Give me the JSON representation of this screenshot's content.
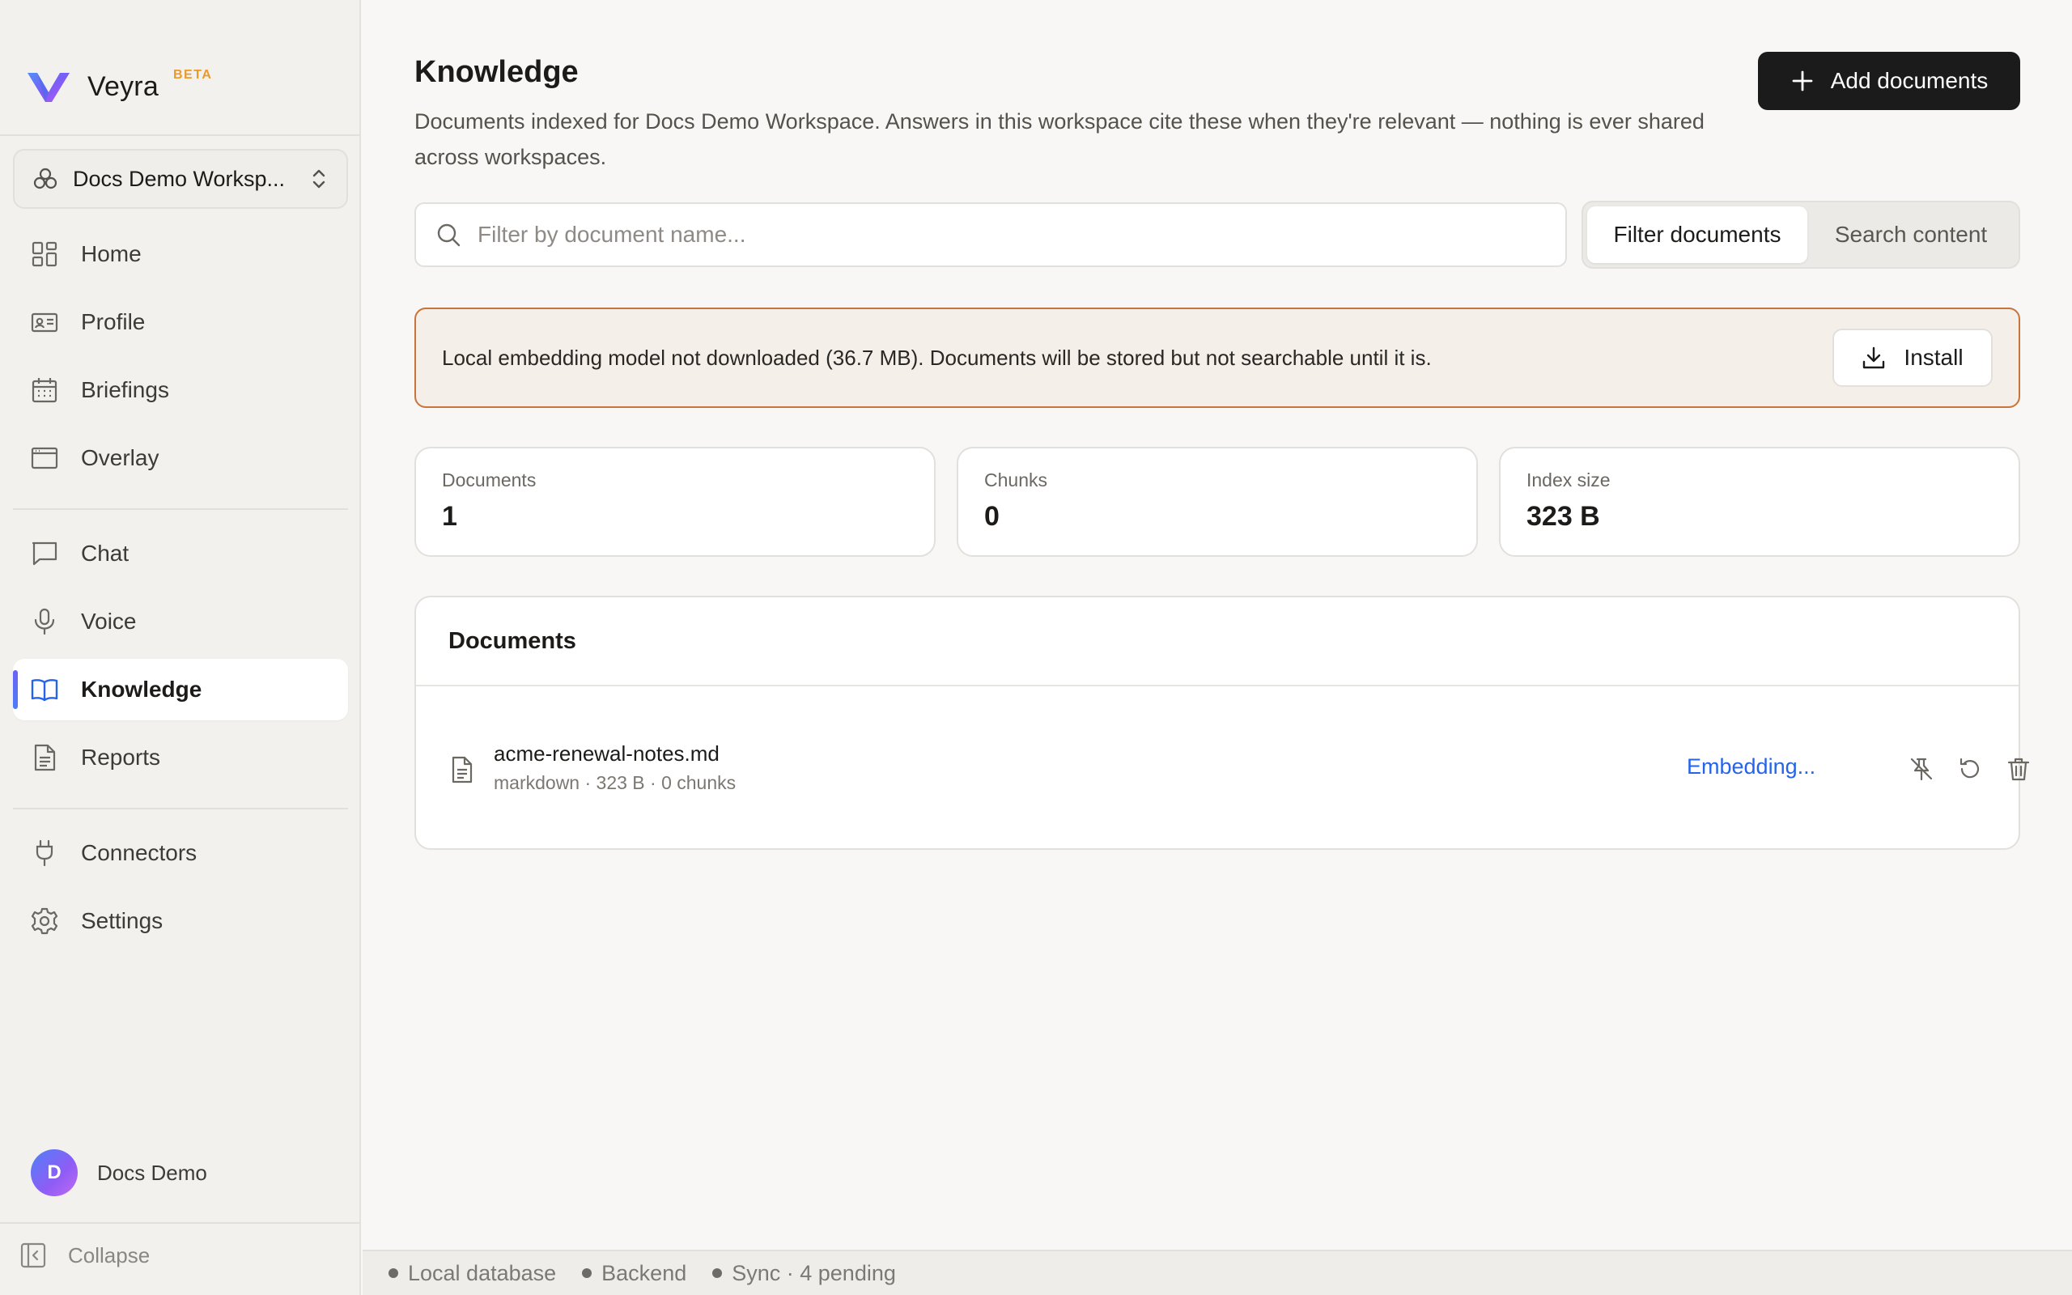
{
  "app": {
    "name": "Veyra",
    "badge": "BETA"
  },
  "workspace": {
    "name": "Docs Demo Worksp..."
  },
  "nav": {
    "home": "Home",
    "profile": "Profile",
    "briefings": "Briefings",
    "overlay": "Overlay",
    "chat": "Chat",
    "voice": "Voice",
    "knowledge": "Knowledge",
    "reports": "Reports",
    "connectors": "Connectors",
    "settings": "Settings"
  },
  "user": {
    "initial": "D",
    "name": "Docs Demo"
  },
  "collapse_label": "Collapse",
  "page": {
    "title": "Knowledge",
    "description": "Documents indexed for Docs Demo Workspace. Answers in this workspace cite these when they're relevant — nothing is ever shared across workspaces.",
    "add_button": "Add documents"
  },
  "search": {
    "placeholder": "Filter by document name...",
    "value": ""
  },
  "mode_toggle": {
    "active": "Filter documents",
    "inactive": "Search content"
  },
  "banner": {
    "text": "Local embedding model not downloaded (36.7 MB). Documents will be stored but not searchable until it is.",
    "button": "Install"
  },
  "stats": [
    {
      "label": "Documents",
      "value": "1"
    },
    {
      "label": "Chunks",
      "value": "0"
    },
    {
      "label": "Index size",
      "value": "323 B"
    }
  ],
  "documents": {
    "title": "Documents",
    "items": [
      {
        "name": "acme-renewal-notes.md",
        "meta": "markdown · 323 B · 0 chunks",
        "status": "Embedding..."
      }
    ]
  },
  "statusbar": {
    "items": [
      "Local database",
      "Backend",
      "Sync · 4 pending"
    ]
  },
  "colors": {
    "accent": "#2563eb",
    "primary_button": "#1b1b1b",
    "banner_border": "#c8743d",
    "beta": "#e89a2c"
  }
}
